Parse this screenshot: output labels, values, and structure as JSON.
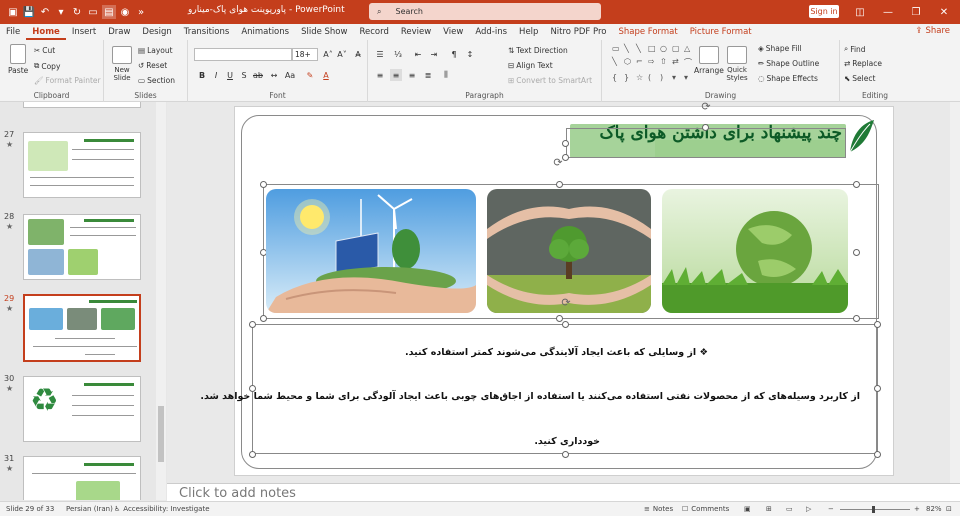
{
  "titlebar": {
    "doc_title": "پاورپوینت هوای پاک-مینارو",
    "app_sep": "-",
    "app_name": "PowerPoint",
    "search_placeholder": "Search",
    "sign_in": "Sign in"
  },
  "menu": {
    "tabs": [
      "File",
      "Home",
      "Insert",
      "Draw",
      "Design",
      "Transitions",
      "Animations",
      "Slide Show",
      "Record",
      "Review",
      "View",
      "Add-ins",
      "Help",
      "Nitro PDF Pro"
    ],
    "context_tabs": [
      "Shape Format",
      "Picture Format"
    ],
    "active_tab": "Home",
    "share": "Share"
  },
  "ribbon": {
    "clipboard": {
      "label": "Clipboard",
      "paste": "Paste",
      "cut": "Cut",
      "copy": "Copy",
      "format_painter": "Format Painter"
    },
    "slides": {
      "label": "Slides",
      "new_slide": "New Slide",
      "layout": "Layout",
      "reset": "Reset",
      "section": "Section"
    },
    "font": {
      "label": "Font",
      "font_name": "",
      "font_size": "18+"
    },
    "paragraph": {
      "label": "Paragraph",
      "text_direction": "Text Direction",
      "align_text": "Align Text",
      "convert_smartart": "Convert to SmartArt"
    },
    "drawing": {
      "label": "Drawing",
      "arrange": "Arrange",
      "quick_styles": "Quick Styles",
      "shape_fill": "Shape Fill",
      "shape_outline": "Shape Outline",
      "shape_effects": "Shape Effects"
    },
    "editing": {
      "label": "Editing",
      "find": "Find",
      "replace": "Replace",
      "select": "Select"
    }
  },
  "slides_panel": {
    "thumbnails": [
      {
        "number": "27",
        "selected": false
      },
      {
        "number": "28",
        "selected": false
      },
      {
        "number": "29",
        "selected": true
      },
      {
        "number": "30",
        "selected": false
      },
      {
        "number": "31",
        "selected": false
      }
    ]
  },
  "slide": {
    "title": "چند پیشنهاد برای داشتن هوای پاک",
    "bullet": "❖",
    "line1": "از وسایلی که باعث ایجاد آلایندگی می‌شوند کمتر استفاده کنید.",
    "line2": "از کاربرد وسیله‌های که از محصولات نفتی استفاده می‌کنند یا استفاده از اجاق‌های چوبی باعث ایجاد آلودگی برای شما و محیط شما خواهد شد.",
    "line3": "خودداری کنید."
  },
  "notes": {
    "placeholder": "Click to add notes"
  },
  "status": {
    "slide_info": "Slide 29 of 33",
    "language": "Persian (Iran)",
    "accessibility": "Accessibility: Investigate",
    "notes": "Notes",
    "comments": "Comments",
    "zoom": "82%"
  },
  "colors": {
    "accent": "#c43e1c",
    "title_green": "#0c5a26",
    "title_band": "#a6d39a"
  }
}
